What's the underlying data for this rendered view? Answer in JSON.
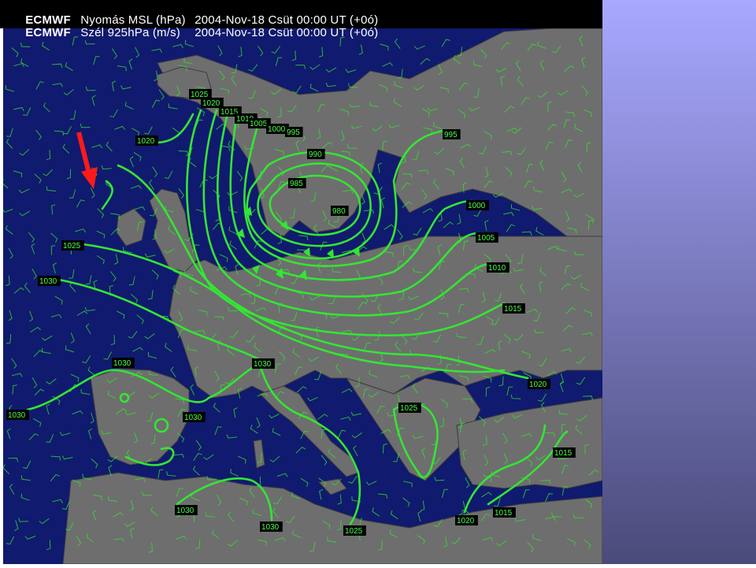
{
  "header": {
    "line1": {
      "source": "ECMWF",
      "variable": "Nyomás MSL (hPa)",
      "valid": "2004-Nov-18 Csüt 00:00 UT (+0ó)"
    },
    "line2": {
      "source": "ECMWF",
      "variable": "Szél 925hPa (m/s)",
      "valid": "2004-Nov-18 Csüt 00:00 UT (+0ó)"
    }
  },
  "colors": {
    "sea": "#101a6e",
    "land": "#6e6e6e",
    "isobar": "#33e633",
    "wind_barb": "#33e633",
    "label_bg": "#000000",
    "label_text": "#4dff4d",
    "arrow": "#ff1a1a",
    "side_top": "#a8a8ff",
    "side_bottom": "#4a4a7a"
  },
  "isobar_labels": [
    {
      "text": "1025"
    },
    {
      "text": "1020"
    },
    {
      "text": "1015"
    },
    {
      "text": "1010"
    },
    {
      "text": "1005"
    },
    {
      "text": "1000"
    },
    {
      "text": "995"
    },
    {
      "text": "1020"
    },
    {
      "text": "990"
    },
    {
      "text": "985"
    },
    {
      "text": "980"
    },
    {
      "text": "995"
    },
    {
      "text": "1000"
    },
    {
      "text": "1005"
    },
    {
      "text": "1010"
    },
    {
      "text": "1015"
    },
    {
      "text": "1025"
    },
    {
      "text": "1030"
    },
    {
      "text": "1030"
    },
    {
      "text": "1030"
    },
    {
      "text": "1030"
    },
    {
      "text": "1030"
    },
    {
      "text": "1020"
    },
    {
      "text": "1025"
    },
    {
      "text": "1015"
    },
    {
      "text": "1030"
    },
    {
      "text": "1030"
    },
    {
      "text": "1025"
    },
    {
      "text": "1020"
    },
    {
      "text": "1015"
    }
  ],
  "annotation": {
    "arrow": "red-arrow-icon"
  }
}
